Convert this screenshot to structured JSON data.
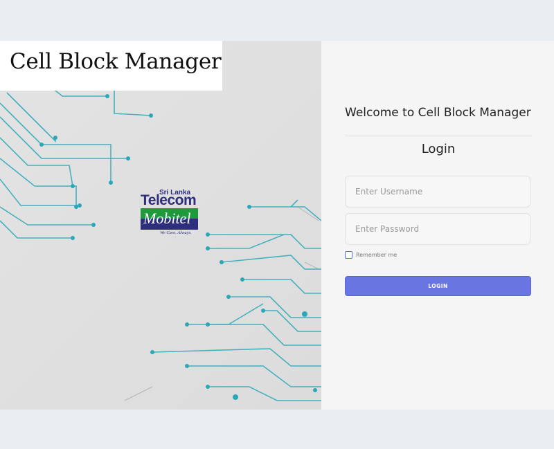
{
  "app": {
    "title": "Cell Block Manager"
  },
  "logo": {
    "line1": "Sri Lanka",
    "line2": "Telecom",
    "line3": "Mobitel",
    "tagline": "We Care. Always."
  },
  "login": {
    "welcome": "Welcome to Cell Block Manager",
    "heading": "Login",
    "username_placeholder": "Enter Username",
    "password_placeholder": "Enter Password",
    "remember_label": "Remember me",
    "button_label": "LOGIN"
  },
  "colors": {
    "accent": "#6975e1",
    "circuit": "#2aa8b8",
    "logo_blue": "#2d2f7c",
    "logo_green": "#1e9a3c"
  }
}
